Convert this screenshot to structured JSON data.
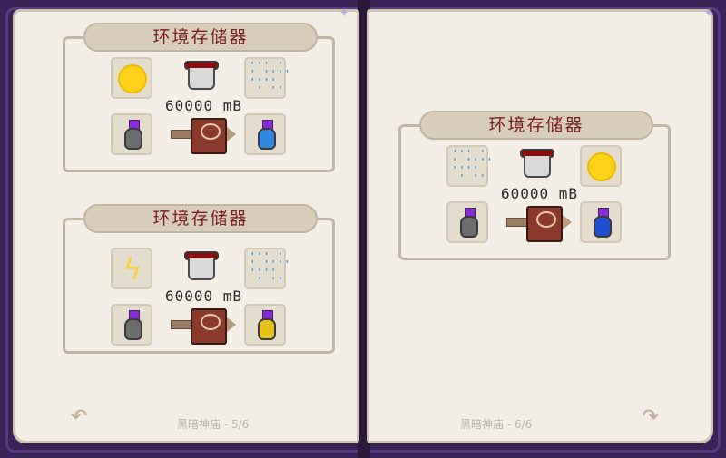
{
  "colors": {
    "title": "#7a1f1f",
    "sun": "#ffd21a",
    "rain": "#3a9fd9",
    "lightning": "#f2d33a",
    "fluid": "#8a0d0d"
  },
  "left_page": {
    "recipes": [
      {
        "title": "环境存储器",
        "top_left_icon": "sun-icon",
        "top_right_icon": "rain-icon",
        "amount": "60000 mB",
        "output_potion_color": "#2f86e0"
      },
      {
        "title": "环境存储器",
        "top_left_icon": "lightning-icon",
        "top_right_icon": "rain-icon",
        "amount": "60000 mB",
        "output_potion_color": "#e4c219"
      }
    ],
    "footer": "黑暗神庙 - 5/6"
  },
  "right_page": {
    "recipes": [
      {
        "title": "环境存储器",
        "top_left_icon": "rain-icon",
        "top_right_icon": "sun-icon",
        "amount": "60000 mB",
        "output_potion_color": "#1f4fd0"
      }
    ],
    "footer": "黑暗神庙 - 6/6"
  },
  "input_potion_color": "#6c6c6c"
}
